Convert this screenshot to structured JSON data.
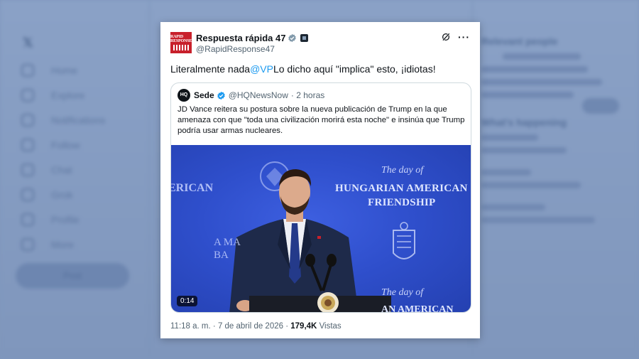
{
  "background": {
    "nav_items": [
      "Home",
      "Explore",
      "Notifications",
      "Follow",
      "Chat",
      "Grok",
      "Profile",
      "More"
    ],
    "post_button": "Post",
    "right_sections": [
      "Relevant people",
      "What's happening"
    ]
  },
  "tweet": {
    "author_name": "Respuesta rápida 47",
    "author_handle": "@RapidResponse47",
    "avatar_text": "RAPID RESPONSE",
    "text_before": "Literalmente nada",
    "mention": "@VP",
    "text_after": "Lo dicho aquí \"implica\" esto, ¡idiotas!",
    "time": "11:18 a. m.",
    "separator": "·",
    "date": "7 de abril de 2026",
    "views_count": "179,4K",
    "views_label": "Vistas"
  },
  "quote": {
    "avatar_text": "HQ",
    "name": "Sede",
    "handle": "@HQNewsNow",
    "age": "· 2 horas",
    "text": "JD Vance reitera su postura sobre la nueva publicación de Trump en la que amenaza con que \"toda una civilización morirá esta noche\" e insinúa que Trump podría usar armas nucleares.",
    "video_duration": "0:14",
    "backdrop": {
      "script_line": "The day of",
      "title_line1": "HUNGARIAN AMERICAN",
      "title_line2": "FRIENDSHIP",
      "left_text": "ERICAN",
      "left_text2": "A MA\nBA",
      "bottom_text": "AN AMERICAN"
    }
  },
  "colors": {
    "accent": "#1d9bf0",
    "avatar_red": "#c8202b",
    "stage_blue": "#2f4fcc"
  }
}
